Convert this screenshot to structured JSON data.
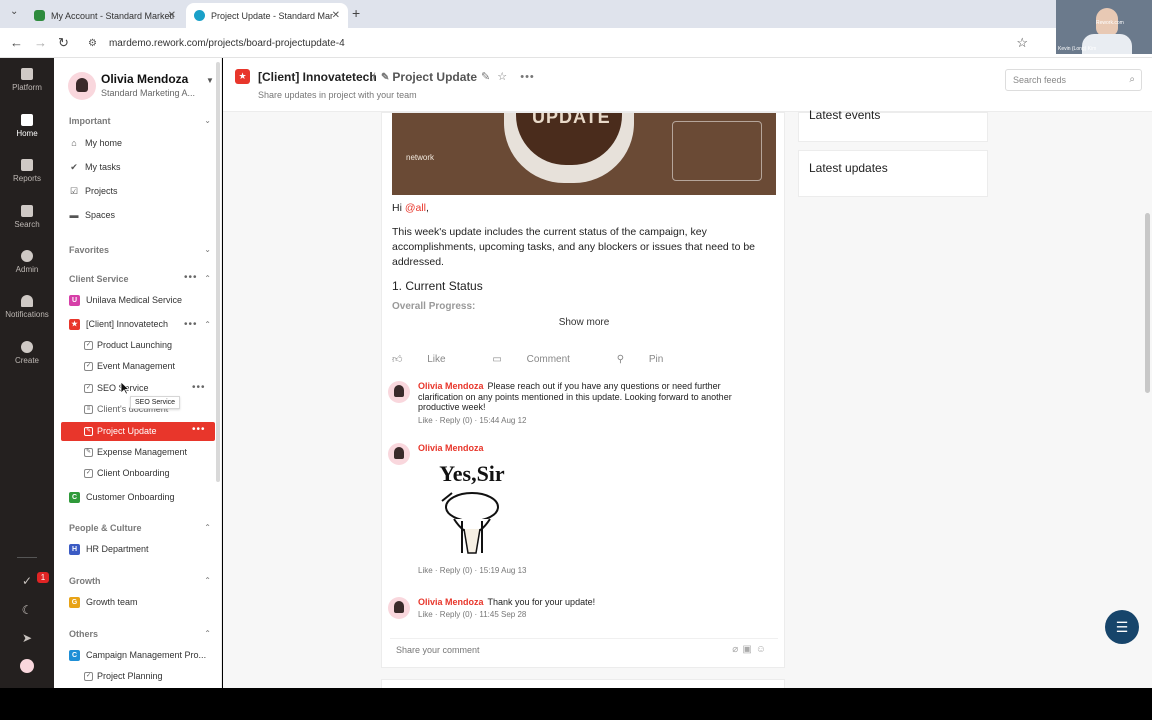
{
  "browser": {
    "tabs": [
      {
        "title": "My Account - Standard Marketi",
        "active": false
      },
      {
        "title": "Project Update - Standard Mar",
        "active": true
      }
    ],
    "new_tab": "+",
    "url": "mardemo.rework.com/projects/board-projectupdate-4"
  },
  "webcam": {
    "brand": "Rework.com",
    "caption": "Kevin (Long) Kim"
  },
  "rail": {
    "items": [
      {
        "label": "Platform",
        "icon": "platform-icon"
      },
      {
        "label": "Home",
        "icon": "home-icon",
        "active": true
      },
      {
        "label": "Reports",
        "icon": "reports-icon"
      },
      {
        "label": "Search",
        "icon": "search-icon"
      },
      {
        "label": "Admin",
        "icon": "admin-icon"
      },
      {
        "label": "Notifications",
        "icon": "bell-icon"
      },
      {
        "label": "Create",
        "icon": "plus-icon"
      }
    ],
    "task_badge": "1"
  },
  "sidebar": {
    "user_name": "Olivia Mendoza",
    "user_org": "Standard Marketing A...",
    "important_label": "Important",
    "important_items": [
      "My home",
      "My tasks",
      "Projects",
      "Spaces"
    ],
    "favorites_label": "Favorites",
    "client_service_label": "Client Service",
    "client_items": [
      "Unilava Medical Service",
      "[Client] Innovatetech"
    ],
    "innovatetech_children": [
      "Product Launching",
      "Event Management",
      "SEO Service",
      "Client's document",
      "Project Update",
      "Expense Management",
      "Client Onboarding"
    ],
    "customer_onboarding": "Customer Onboarding",
    "people_label": "People & Culture",
    "hr": "HR Department",
    "growth_label": "Growth",
    "growth_team": "Growth team",
    "others_label": "Others",
    "campaign": "Campaign Management Pro...",
    "planning": "Project Planning",
    "tooltip": "SEO Service"
  },
  "header": {
    "project": "[Client] Innovatetech",
    "separator": "/",
    "board": "Project Update",
    "subtitle": "Share updates in project with your team",
    "search_placeholder": "Search feeds"
  },
  "post": {
    "banner_word": "UPDATE",
    "banner_network": "network",
    "greeting": "Hi",
    "mention": "@all",
    "greeting_comma": ",",
    "body": "This week's update includes the current status of the campaign, key accomplishments, upcoming tasks, and any blockers or issues that need to be addressed.",
    "heading": "1. Current Status",
    "faded": "Overall Progress:",
    "show_more": "Show more",
    "like": "Like",
    "comment": "Comment",
    "pin": "Pin"
  },
  "comments": [
    {
      "author": "Olivia Mendoza",
      "text": "Please reach out if you have any questions or need further clarification on any points mentioned in this update. Looking forward to another productive week!",
      "meta": "Like · Reply (0) · 15:44 Aug 12"
    },
    {
      "author": "Olivia Mendoza",
      "text": "",
      "meta": "Like · Reply (0) · 15:19 Aug 13",
      "sticker_text": "Yes,Sir"
    },
    {
      "author": "Olivia Mendoza",
      "text": "Thank you for your update!",
      "meta": "Like · Reply (0) · 11:45 Sep 28"
    }
  ],
  "reply_placeholder": "Share your comment",
  "right": {
    "latest_events": "Latest events",
    "latest_updates": "Latest updates"
  },
  "colors": {
    "accent": "#e8362b",
    "rail": "#24201f",
    "chat": "#17456b"
  }
}
